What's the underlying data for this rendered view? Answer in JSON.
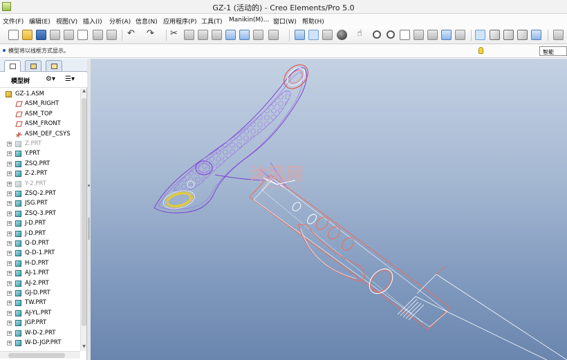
{
  "window": {
    "title": "GZ-1 (活动的) - Creo Elements/Pro 5.0"
  },
  "menu": [
    "文件(F)",
    "编辑(E)",
    "视图(V)",
    "插入(I)",
    "分析(A)",
    "信息(N)",
    "应用程序(P)",
    "工具(T)",
    "Manikin(M)...",
    "窗口(W)",
    "帮助(H)"
  ],
  "toolbar": {
    "icons": [
      "new-icon",
      "open-icon",
      "save-icon",
      "print-icon",
      "copy-icon",
      "close-window-icon",
      "erase-icon",
      "regenerate-icon",
      "undo-icon",
      "redo-icon",
      "cut-icon",
      "copy-icon",
      "paste-icon",
      "paste-special-icon",
      "relations-icon",
      "find-icon",
      "selection-icon",
      "datum-display-icon",
      "spin-center-icon",
      "appearance-icon",
      "zoom-in-icon",
      "zoom-out-icon",
      "refit-icon",
      "orient-icon",
      "saved-views-icon",
      "layers-icon",
      "shading-icon",
      "wireframe-icon",
      "hidden-line-icon",
      "no-hidden-icon",
      "shaded-icon",
      "sketch-icon"
    ]
  },
  "message": {
    "text": "模型将以线框方式显示。"
  },
  "filter": {
    "value": "智能"
  },
  "model_tree": {
    "header": "模型树",
    "items": [
      {
        "name": "GZ-1.ASM",
        "type": "asm",
        "dim": false
      },
      {
        "name": "ASM_RIGHT",
        "type": "plane",
        "dim": false
      },
      {
        "name": "ASM_TOP",
        "type": "plane",
        "dim": false
      },
      {
        "name": "ASM_FRONT",
        "type": "plane",
        "dim": false
      },
      {
        "name": "ASM_DEF_CSYS",
        "type": "csys",
        "dim": false
      },
      {
        "name": "Z.PRT",
        "type": "part",
        "dim": true
      },
      {
        "name": "Y.PRT",
        "type": "part",
        "dim": false
      },
      {
        "name": "ZSQ.PRT",
        "type": "part",
        "dim": false
      },
      {
        "name": "Z-2.PRT",
        "type": "part",
        "dim": false
      },
      {
        "name": "Y-2.PRT",
        "type": "part",
        "dim": true
      },
      {
        "name": "ZSQ-2.PRT",
        "type": "part",
        "dim": false
      },
      {
        "name": "JSG.PRT",
        "type": "part",
        "dim": false
      },
      {
        "name": "ZSQ-3.PRT",
        "type": "part",
        "dim": false
      },
      {
        "name": "J-D.PRT",
        "type": "part",
        "dim": false
      },
      {
        "name": "J-D.PRT",
        "type": "part",
        "dim": false
      },
      {
        "name": "Q-D.PRT",
        "type": "part",
        "dim": false
      },
      {
        "name": "Q-D-1.PRT",
        "type": "part",
        "dim": false
      },
      {
        "name": "H-D.PRT",
        "type": "part",
        "dim": false
      },
      {
        "name": "AJ-1.PRT",
        "type": "part",
        "dim": false
      },
      {
        "name": "AJ-2.PRT",
        "type": "part",
        "dim": false
      },
      {
        "name": "GJ-D.PRT",
        "type": "part",
        "dim": false
      },
      {
        "name": "TW.PRT",
        "type": "part",
        "dim": false
      },
      {
        "name": "AJ-YL.PRT",
        "type": "part",
        "dim": false
      },
      {
        "name": "JGP.PRT",
        "type": "part",
        "dim": false
      },
      {
        "name": "W-D-2.PRT",
        "type": "part",
        "dim": false
      },
      {
        "name": "W-D-JGP.PRT",
        "type": "part",
        "dim": false
      }
    ]
  },
  "watermark": {
    "text": "沐风网",
    "sub": "www.mfcad.com"
  },
  "colors": {
    "viewport_top": "#c4d1e3",
    "viewport_bottom": "#6a86ae",
    "edge_purple": "#7a3fd0",
    "edge_red": "#e0453a",
    "edge_white": "#ffffff",
    "edge_yellow": "#f0d020"
  }
}
